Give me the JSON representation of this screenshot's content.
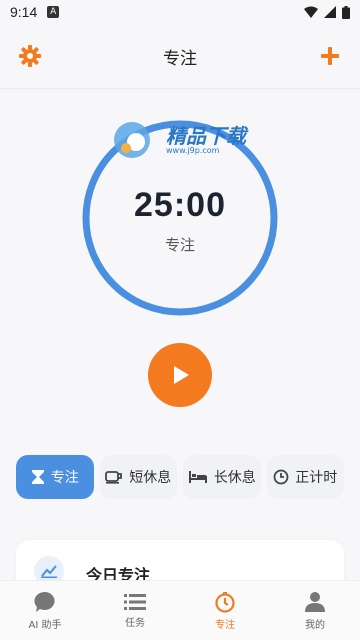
{
  "status": {
    "time": "9:14",
    "notif": "A"
  },
  "header": {
    "title": "专注"
  },
  "timer": {
    "time": "25:00",
    "mode": "专注",
    "progress": 1.0
  },
  "watermark": {
    "text": "精品下载",
    "url": "www.j9p.com"
  },
  "modes": [
    {
      "label": "专注",
      "icon": "hourglass-icon",
      "active": true
    },
    {
      "label": "短休息",
      "icon": "coffee-icon",
      "active": false
    },
    {
      "label": "长休息",
      "icon": "bed-icon",
      "active": false
    },
    {
      "label": "正计时",
      "icon": "clock-icon",
      "active": false
    }
  ],
  "card": {
    "title": "今日专注"
  },
  "nav": [
    {
      "label": "AI 助手",
      "icon": "chat-icon",
      "active": false
    },
    {
      "label": "任务",
      "icon": "list-icon",
      "active": false
    },
    {
      "label": "专注",
      "icon": "focus-timer-icon",
      "active": true
    },
    {
      "label": "我的",
      "icon": "person-icon",
      "active": false
    }
  ],
  "colors": {
    "accent": "#f47a1f",
    "primary": "#4a8fe0",
    "ring": "#4a8fe0"
  }
}
